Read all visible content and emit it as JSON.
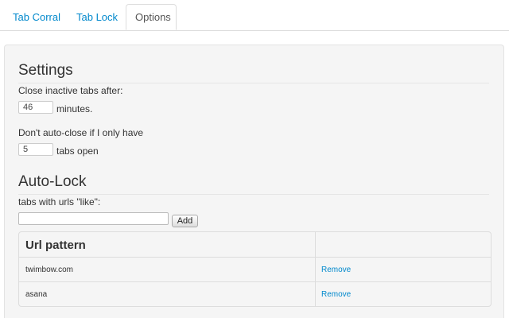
{
  "tabs": [
    {
      "label": "Tab Corral"
    },
    {
      "label": "Tab Lock"
    },
    {
      "label": "Options",
      "active": true
    }
  ],
  "settings": {
    "heading": "Settings",
    "close_label": "Close inactive tabs after:",
    "close_value": "46",
    "close_unit": "minutes.",
    "keep_label": "Don't auto-close if I only have",
    "keep_value": "5",
    "keep_unit": "tabs open"
  },
  "autolock": {
    "heading": "Auto-Lock",
    "label": "tabs with urls \"like\":",
    "input_value": "",
    "add_button": "Add",
    "table_header": "Url pattern",
    "rows": [
      {
        "pattern": "twimbow.com",
        "action": "Remove"
      },
      {
        "pattern": "asana",
        "action": "Remove"
      }
    ]
  }
}
